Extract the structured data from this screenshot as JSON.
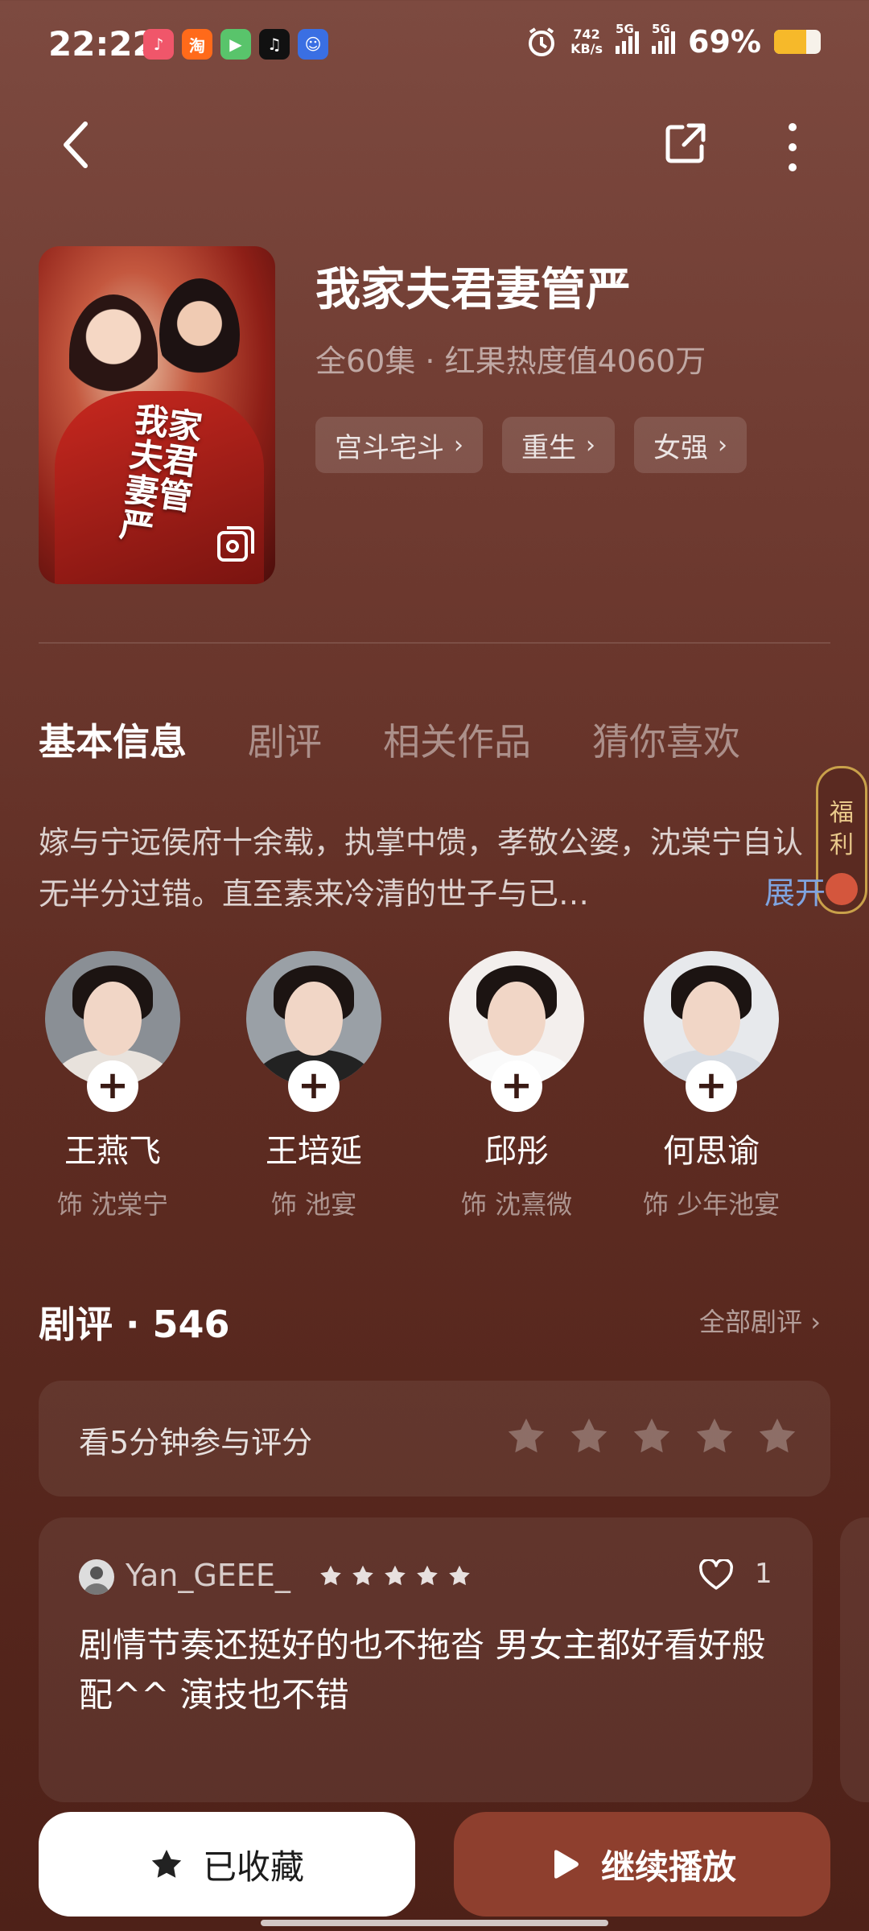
{
  "status_bar": {
    "time": "22:22",
    "net_speed_value": "742",
    "net_speed_unit": "KB/s",
    "signal1": "5G",
    "signal2": "5G",
    "battery": "69%",
    "battery_level": 0.69,
    "app_icons": [
      "douyin-icon",
      "taobao-icon",
      "video-icon",
      "tiktok-icon",
      "app-icon"
    ]
  },
  "header": {
    "back_icon": "chevron-left-icon",
    "share_icon": "share-icon",
    "more_icon": "more-vertical-icon"
  },
  "drama": {
    "title": "我家夫君妻管严",
    "meta": "全60集 · 红果热度值4060万",
    "poster_text": "我家夫君妻管严",
    "tags": [
      {
        "label": "宫斗宅斗"
      },
      {
        "label": "重生"
      },
      {
        "label": "女强"
      }
    ]
  },
  "tabs": [
    {
      "label": "基本信息"
    },
    {
      "label": "剧评"
    },
    {
      "label": "相关作品"
    },
    {
      "label": "猜你喜欢"
    }
  ],
  "welfare": {
    "label": "福利"
  },
  "synopsis": {
    "text": "嫁与宁远侯府十余载，执掌中馈，孝敬公婆，沈棠宁自认无半分过错。直至素来冷清的世子与已…",
    "expand_label": "展开"
  },
  "cast": [
    {
      "name": "王燕飞",
      "role": "饰 沈棠宁"
    },
    {
      "name": "王培延",
      "role": "饰 池宴"
    },
    {
      "name": "邱彤",
      "role": "饰 沈熹微"
    },
    {
      "name": "何思谕",
      "role": "饰 少年池宴"
    }
  ],
  "reviews": {
    "title": "剧评 · 546",
    "all_label": "全部剧评",
    "rate_prompt": "看5分钟参与评分",
    "rate_stars": 5,
    "items": [
      {
        "user": "Yan_GEEE_",
        "stars": 5,
        "likes": "1",
        "text": "剧情节奏还挺好的也不拖沓 男女主都好看好般配^^ 演技也不错"
      }
    ]
  },
  "bottom": {
    "collect_label": "已收藏",
    "play_label": "继续播放"
  },
  "colors": {
    "accent": "#8e3f2e",
    "link": "#7fa4e0",
    "battery": "#f6b92a"
  }
}
